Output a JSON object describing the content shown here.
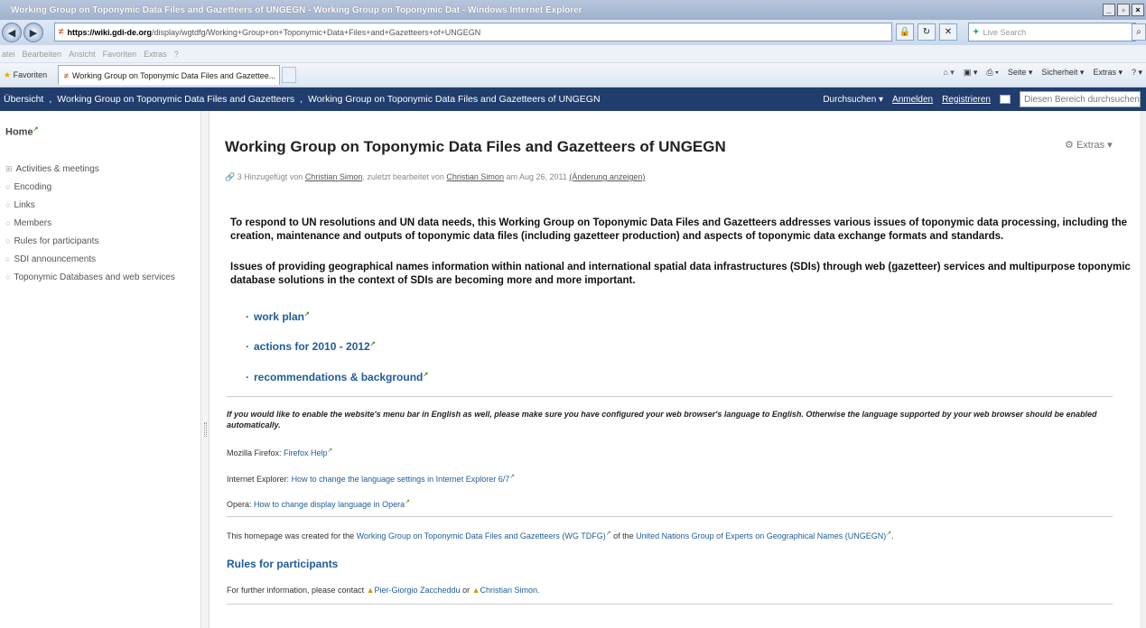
{
  "window": {
    "title": "Working Group on Toponymic Data Files and Gazetteers of UNGEGN - Working Group on Toponymic Dat - Windows Internet Explorer",
    "buttons": [
      "_",
      "▫",
      "×"
    ]
  },
  "address": {
    "url_host": "https://wiki.gdi-de.org",
    "url_path": "/display/wgtdfg/Working+Group+on+Toponymic+Data+Files+and+Gazetteers+of+UNGEGN",
    "search_placeholder": "Live Search"
  },
  "menu": {
    "items": [
      "atei",
      "Bearbeiten",
      "Ansicht",
      "Favoriten",
      "Extras",
      "?"
    ]
  },
  "tabs": {
    "favorites_label": "Favoriten",
    "active_tab": "Working Group on Toponymic Data Files and Gazettee...",
    "commands": [
      "Seite ▾",
      "Sicherheit ▾",
      "Extras ▾"
    ]
  },
  "breadcrumb": {
    "items": [
      "Übersicht",
      "Working Group on Toponymic Data Files and Gazetteers",
      "Working Group on Toponymic Data Files and Gazetteers of UNGEGN"
    ],
    "browse": "Durchsuchen ▾",
    "login": "Anmelden",
    "register": "Registrieren",
    "search_placeholder": "Diesen Bereich durchsuchen"
  },
  "sidebar": {
    "home": "Home",
    "items": [
      {
        "label": "Activities & meetings"
      },
      {
        "label": "Encoding"
      },
      {
        "label": "Links"
      },
      {
        "label": "Members"
      },
      {
        "label": "Rules for participants"
      },
      {
        "label": "SDI announcements"
      },
      {
        "label": "Toponymic Databases and web services"
      }
    ]
  },
  "page": {
    "title": "Working Group on Toponymic Data Files and Gazetteers of UNGEGN",
    "extras": "Extras ▾",
    "meta_prefix": "3 Hinzugefügt von",
    "meta_author1": "Christian Simon",
    "meta_mid": ", zuletzt bearbeitet von",
    "meta_author2": "Christian Simon",
    "meta_date": "am Aug 26, 2011",
    "meta_changes": "(Änderung anzeigen)",
    "intro_1": "To respond to UN resolutions and UN data needs, this Working Group on Toponymic Data Files and Gazetteers addresses various issues of toponymic data processing, including the creation, maintenance and outputs of toponymic data files (including gazetteer production) and aspects of toponymic data exchange formats and standards.",
    "intro_2": "Issues of providing geographical names information within national and international spatial data infrastructures (SDIs) through web (gazetteer) services and multipurpose toponymic database solutions in the context of SDIs are becoming more and more important.",
    "links": [
      "work plan",
      "actions for 2010 - 2012",
      "recommendations & background"
    ],
    "lang_note": "If you would like to enable the website's menu bar in English as well, please make sure you have configured your web browser's language to English. Otherwise the language supported by your web browser should be enabled automatically.",
    "firefox_label": "Mozilla Firefox:",
    "firefox_link": "Firefox Help",
    "ie_label": "Internet Explorer:",
    "ie_link": "How to change the language settings in Internet Explorer 6/7",
    "opera_label": "Opera:",
    "opera_link": "How to change display language in Opera",
    "credit_prefix": "This homepage was created for the",
    "credit_link1": "Working Group on Toponymic Data Files and Gazetteers (WG TDFG)",
    "credit_mid": "of the",
    "credit_link2": "United Nations Group of Experts on Geographical Names (UNGEGN)",
    "credit_end": ".",
    "rules_heading": "Rules for participants",
    "contact_prefix": "For further information, please contact",
    "contact_person1": "Pier-Giorgio Zaccheddu",
    "contact_or": "or",
    "contact_person2": "Christian Simon."
  }
}
